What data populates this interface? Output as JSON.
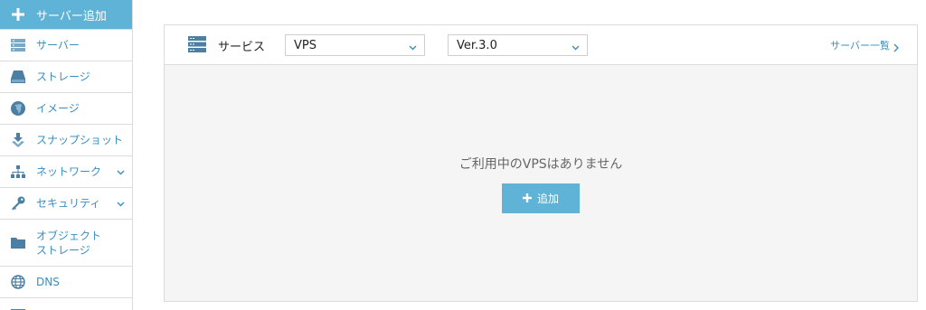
{
  "sidebar": {
    "primary_label": "サーバー追加",
    "items": [
      {
        "label": "サーバー",
        "icon": "server-stack-icon"
      },
      {
        "label": "ストレージ",
        "icon": "disk-icon"
      },
      {
        "label": "イメージ",
        "icon": "globe-disc-icon"
      },
      {
        "label": "スナップショット",
        "icon": "snapshot-icon"
      },
      {
        "label": "ネットワーク",
        "icon": "network-icon"
      },
      {
        "label": "セキュリティ",
        "icon": "key-icon"
      },
      {
        "label_line1": "オブジェクト",
        "label_line2": "ストレージ",
        "icon": "folder-icon"
      },
      {
        "label": "DNS",
        "icon": "globe-icon"
      }
    ]
  },
  "toolbar": {
    "service_label": "サービス",
    "service_select": "VPS",
    "version_select": "Ver.3.0",
    "server_list_link": "サーバー一覧"
  },
  "main": {
    "empty_message": "ご利用中のVPSはありません",
    "add_button_label": "追加"
  },
  "colors": {
    "accent": "#5fb3d6",
    "link": "#3a8fc2",
    "panel_bg": "#f5f5f5",
    "border": "#dcdcdc"
  }
}
